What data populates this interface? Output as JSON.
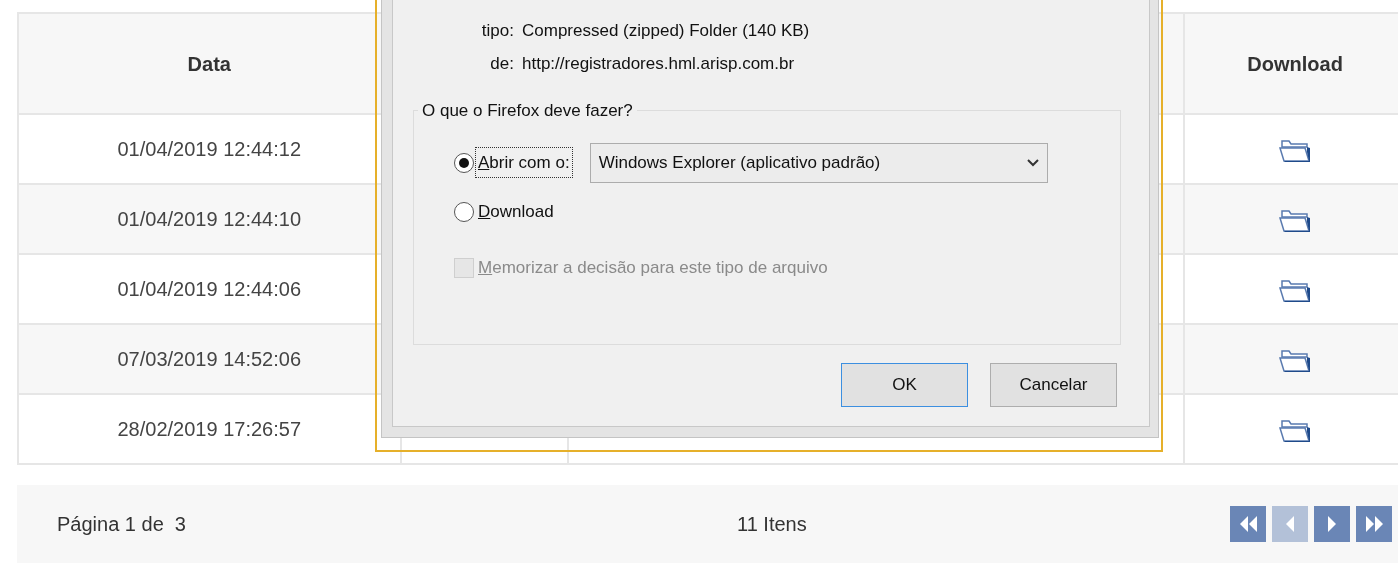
{
  "table": {
    "columns": [
      {
        "label": "Data"
      },
      {
        "label": "Download"
      }
    ],
    "rows": [
      {
        "date": "01/04/2019 12:44:12",
        "download": true
      },
      {
        "date": "01/04/2019 12:44:10",
        "download": true
      },
      {
        "date": "01/04/2019 12:44:06",
        "download": true
      },
      {
        "date": "07/03/2019 14:52:06",
        "download": true
      },
      {
        "date": "28/02/2019 17:26:57",
        "download": true
      }
    ]
  },
  "pager": {
    "page_label": "Página 1 de  3",
    "item_count": "11 Itens",
    "buttons": [
      {
        "kind": "first",
        "disabled": false
      },
      {
        "kind": "prev",
        "disabled": true
      },
      {
        "kind": "next",
        "disabled": false
      },
      {
        "kind": "last",
        "disabled": false
      }
    ]
  },
  "dialog": {
    "info": [
      {
        "label": "tipo:",
        "value": "Compressed (zipped) Folder (140 KB)"
      },
      {
        "label": "de:",
        "value": "http://registradores.hml.arisp.com.br"
      }
    ],
    "group_title": "O que o Firefox deve fazer?",
    "options": [
      {
        "kind": "radio",
        "label": "Abrir com o:",
        "selected": true,
        "focused": true,
        "access_key": true,
        "app": "Windows Explorer (aplicativo padrão)"
      },
      {
        "kind": "radio",
        "label": "Download",
        "selected": false,
        "focused": false,
        "access_key": true
      },
      {
        "kind": "checkbox",
        "label": "Memorizar a decisão para este tipo de arquivo",
        "checked": false,
        "disabled": true,
        "access_key": true
      }
    ],
    "buttons": [
      {
        "label": "OK",
        "default": true
      },
      {
        "label": "Cancelar",
        "default": false
      }
    ]
  }
}
